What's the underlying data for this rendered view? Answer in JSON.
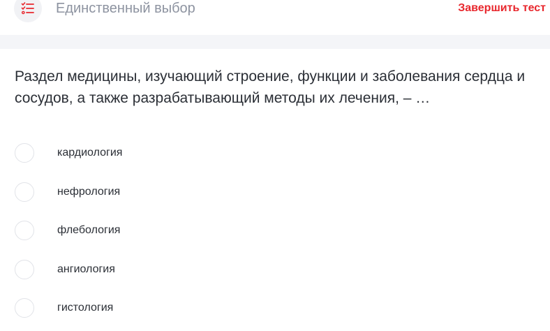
{
  "header": {
    "type_icon": "checklist-icon",
    "question_type": "Единственный выбор",
    "finish_label": "Завершить тест"
  },
  "question": {
    "text": "Раздел медицины, изучающий строение, функции и заболевания сердца и сосудов, а также разрабатывающий методы их лечения, – …"
  },
  "options": [
    {
      "label": "кардиология",
      "selected": false
    },
    {
      "label": "нефрология",
      "selected": false
    },
    {
      "label": "флебология",
      "selected": false
    },
    {
      "label": "ангиология",
      "selected": false
    },
    {
      "label": "гистология",
      "selected": false
    }
  ],
  "colors": {
    "accent_red": "#e8272d",
    "muted_text": "#8d93a0",
    "body_text": "#2b2f36",
    "band": "#f4f5f8"
  }
}
